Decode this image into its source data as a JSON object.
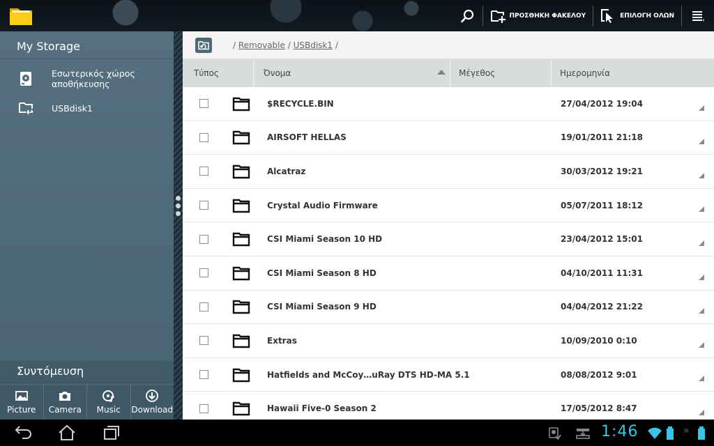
{
  "actionbar": {
    "add_folder_label": "ΠΡΟΣΘΗΚΗ ΦΑΚΕΛΟΥ",
    "select_all_label": "ΕΠΙΛΟΓΗ ΟΛΩΝ",
    "icons": [
      "file-manager-app-icon",
      "search-icon",
      "add-folder-icon",
      "select-all-icon",
      "menu-icon"
    ]
  },
  "sidebar": {
    "title": "My Storage",
    "items": [
      {
        "label": "Εσωτερικός χώρος αποθήκευσης",
        "icon": "internal-storage-icon"
      },
      {
        "label": "USBdisk1",
        "icon": "usb-disk-icon"
      }
    ],
    "shortcut_title": "Συντόμευση",
    "shortcuts": [
      {
        "label": "Picture",
        "icon": "picture-icon"
      },
      {
        "label": "Camera",
        "icon": "camera-icon"
      },
      {
        "label": "Music",
        "icon": "music-icon"
      },
      {
        "label": "Download",
        "icon": "download-icon"
      }
    ]
  },
  "path": {
    "prefix": "/",
    "segments": [
      "Removable",
      "USBdisk1"
    ],
    "separator": "/",
    "suffix": "/"
  },
  "table": {
    "columns": {
      "type": "Τύπος",
      "name": "Όνομα",
      "size": "Μέγεθος",
      "date": "Ημερομηνία"
    },
    "sort_column": "name",
    "rows": [
      {
        "name": "$RECYCLE.BIN",
        "date": "27/04/2012 19:04"
      },
      {
        "name": "AIRSOFT HELLAS",
        "date": "19/01/2011 21:18"
      },
      {
        "name": "Alcatraz",
        "date": "30/03/2012 19:21"
      },
      {
        "name": "Crystal Audio Firmware",
        "date": "05/07/2011 18:12"
      },
      {
        "name": "CSI Miami Season 10 HD",
        "date": "23/04/2012 15:01"
      },
      {
        "name": "CSI Miami Season 8 HD",
        "date": "04/10/2011 11:31"
      },
      {
        "name": "CSI Miami Season 9 HD",
        "date": "04/04/2012 21:22"
      },
      {
        "name": "Extras",
        "date": "10/09/2010 0:10"
      },
      {
        "name": "Hatfields and McCoy…uRay DTS HD-MA 5.1",
        "date": "08/08/2012 9:01"
      },
      {
        "name": "Hawaii Five-0 Season 2",
        "date": "17/05/2012 8:47"
      }
    ]
  },
  "statusbar": {
    "time": "1:46",
    "colors": {
      "clock": "#39c5e8"
    },
    "icons": [
      "back-icon",
      "home-icon",
      "recent-apps-icon",
      "usb-debug-icon",
      "storage-notification-icon",
      "wifi-icon",
      "battery-icon"
    ]
  }
}
